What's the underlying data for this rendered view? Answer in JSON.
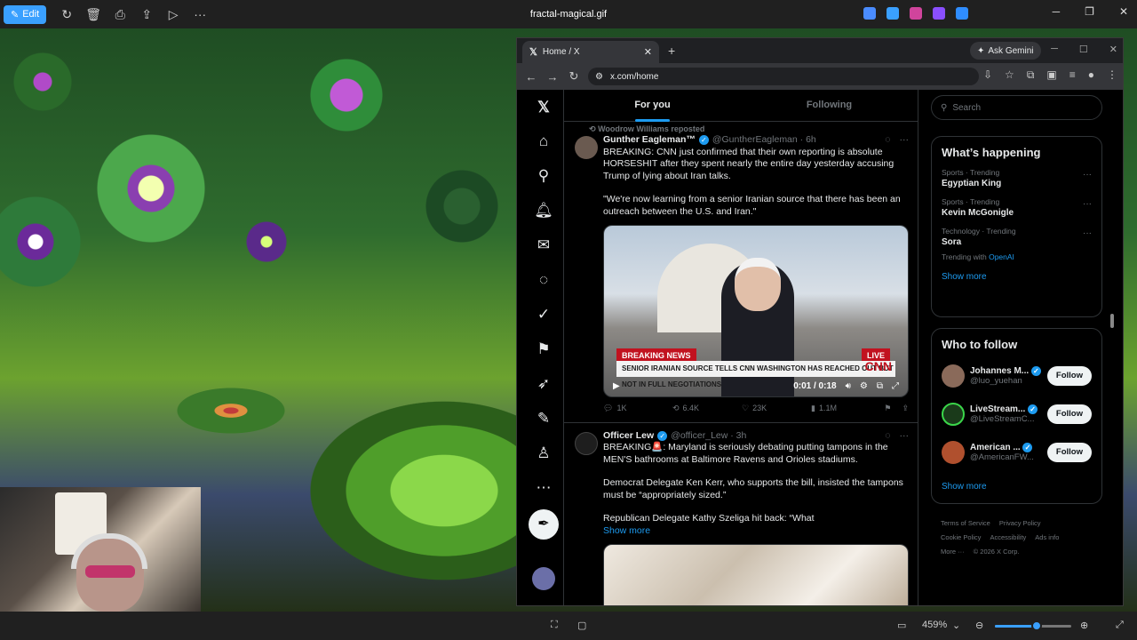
{
  "viewer": {
    "edit_label": "Edit",
    "file_name": "fractal-magical.gif",
    "zoom": "459%",
    "zoom_fraction": 0.55,
    "tray_colors": [
      "#4a8cff",
      "#3aa0ff",
      "#d0449c",
      "#8a4fff",
      "#2f8dff"
    ]
  },
  "browser": {
    "tab_title": "Home / X",
    "gemini_label": "Ask Gemini",
    "url": "x.com/home"
  },
  "feed": {
    "tab_for_you": "For you",
    "tab_following": "Following",
    "tweet1": {
      "repost_label": "Woodrow Williams reposted",
      "name": "Gunther Eagleman™",
      "handle": "@GuntherEagleman · 6h",
      "text1": "BREAKING: CNN just confirmed that their own reporting is absolute HORSESHIT after they spent nearly the entire day yesterday accusing Trump of lying about Iran talks.",
      "text2": "\"We're now learning from a senior Iranian source that there has been an outreach between the U.S. and Iran.\"",
      "video_breaking": "BREAKING NEWS",
      "video_live": "LIVE",
      "video_chyron": "SENIOR IRANIAN SOURCE TELLS CNN WASHINGTON HAS REACHED OUT BUT NOT IN FULL NEGOTIATIONS",
      "video_network": "CNN",
      "video_time": "0:01 / 0:18",
      "replies": "1K",
      "reposts": "6.4K",
      "likes": "23K",
      "views": "1.1M"
    },
    "tweet2": {
      "name": "Officer Lew",
      "handle": "@officer_Lew · 3h",
      "text1": "BREAKING🚨: Maryland is seriously debating putting tampons in the MEN'S bathrooms at Baltimore Ravens and Orioles stadiums.",
      "text2": "Democrat Delegate Ken Kerr, who supports the bill, insisted the tampons must be “appropriately sized.”",
      "text3": "Republican Delegate Kathy Szeliga hit back: “What",
      "show_more": "Show more"
    }
  },
  "sidebar": {
    "search_placeholder": "Search",
    "happening_title": "What’s happening",
    "trends": [
      {
        "meta": "Sports · Trending",
        "name": "Egyptian King"
      },
      {
        "meta": "Sports · Trending",
        "name": "Kevin McGonigle"
      },
      {
        "meta": "Technology · Trending",
        "name": "Sora",
        "extra_prefix": "Trending with ",
        "extra_link": "OpenAI"
      }
    ],
    "show_more": "Show more",
    "who_title": "Who to follow",
    "follow_label": "Follow",
    "suggestions": [
      {
        "name": "Johannes M...",
        "handle": "@luo_yuehan"
      },
      {
        "name": "LiveStream...",
        "handle": "@LiveStreamC..."
      },
      {
        "name": "American ...",
        "handle": "@AmericanFW..."
      }
    ],
    "footer": {
      "terms": "Terms of Service",
      "privacy": "Privacy Policy",
      "cookie": "Cookie Policy",
      "accessibility": "Accessibility",
      "ads": "Ads info",
      "more": "More ···",
      "copyright": "© 2026 X Corp."
    }
  }
}
